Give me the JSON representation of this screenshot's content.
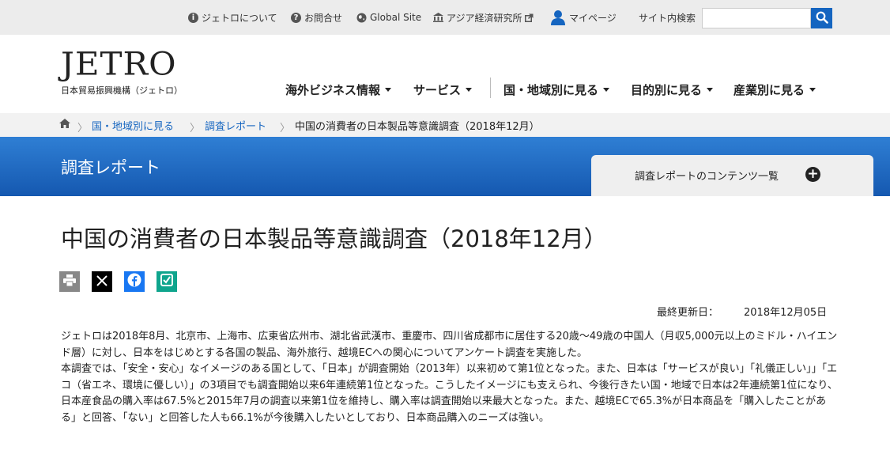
{
  "utility": {
    "about": "ジェトロについて",
    "contact": "お問合せ",
    "global": "Global Site",
    "ide": "アジア経済研究所",
    "mypage": "マイページ",
    "search_label": "サイト内検索",
    "search_placeholder": ""
  },
  "logo": {
    "wordmark": "JETRO",
    "subtitle": "日本貿易振興機構（ジェトロ）"
  },
  "nav": {
    "items": [
      {
        "label": "海外ビジネス情報"
      },
      {
        "label": "サービス"
      },
      {
        "label": "国・地域別に見る"
      },
      {
        "label": "目的別に見る"
      },
      {
        "label": "産業別に見る"
      }
    ]
  },
  "breadcrumb": {
    "items": [
      "国・地域別に見る",
      "調査レポート"
    ],
    "current": "中国の消費者の日本製品等意識調査（2018年12月）"
  },
  "band": {
    "title": "調査レポート",
    "contents_label": "調査レポートのコンテンツ一覧"
  },
  "article": {
    "title": "中国の消費者の日本製品等意識調査（2018年12月）",
    "updated_label": "最終更新日：",
    "updated_date": "2018年12月05日",
    "paragraphs": [
      "ジェトロは2018年8月、北京市、上海市、広東省広州市、湖北省武漢市、重慶市、四川省成都市に居住する20歳～49歳の中国人（月収5,000元以上のミドル・ハイエンド層）に対し、日本をはじめとする各国の製品、海外旅行、越境ECへの関心についてアンケート調査を実施した。",
      "本調査では、「安全・安心」なイメージのある国として、「日本」が調査開始（2013年）以来初めて第1位となった。また、日本は「サービスが良い」「礼儀正しい」」「エコ（省エネ、環境に優しい）」の3項目でも調査開始以来6年連続第1位となった。こうしたイメージにも支えられ、今後行きたい国・地域で日本は2年連続第1位になり、日本産食品の購入率は67.5%と2015年7月の調査以来第1位を維持し、購入率は調査開始以来最大となった。また、越境ECで65.3%が日本商品を「購入したことがある」と回答、「ない」と回答した人も66.1%が今後購入したいとしており、日本商品購入のニーズは強い。"
    ]
  }
}
